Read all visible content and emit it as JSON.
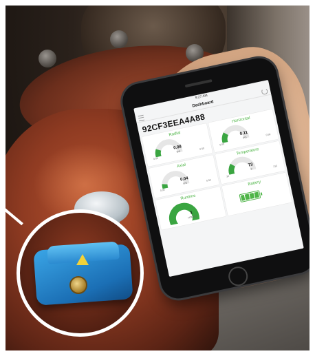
{
  "phone": {
    "status_time": "9:27 AM",
    "screen_title": "Dashboard",
    "device_id": "92CF3EEA4A88",
    "tiles": [
      {
        "label": "Radial",
        "value": "0.08",
        "unit": "IPS",
        "min": "0.00",
        "max": "0.50",
        "fill": 0.16
      },
      {
        "label": "Horizontal",
        "value": "0.11",
        "unit": "IPS",
        "min": "0.00",
        "max": "0.50",
        "fill": 0.22
      },
      {
        "label": "Axial",
        "value": "0.04",
        "unit": "IPS",
        "min": "0.00",
        "max": "0.50",
        "fill": 0.08
      },
      {
        "label": "Temperature",
        "value": "73",
        "unit": "°F",
        "min": "32",
        "max": "212",
        "fill": 0.23
      },
      {
        "label": "Runtime",
        "value": "1",
        "unit": "HOURS"
      },
      {
        "label": "Battery",
        "level": 1.0
      }
    ]
  },
  "colors": {
    "accent_green": "#3aa541",
    "sensor_blue": "#1b6fb5",
    "pump_red": "#8f3b22"
  },
  "icons": [
    "menu-icon",
    "refresh-icon",
    "battery-icon",
    "sensor-arrow-icon"
  ]
}
